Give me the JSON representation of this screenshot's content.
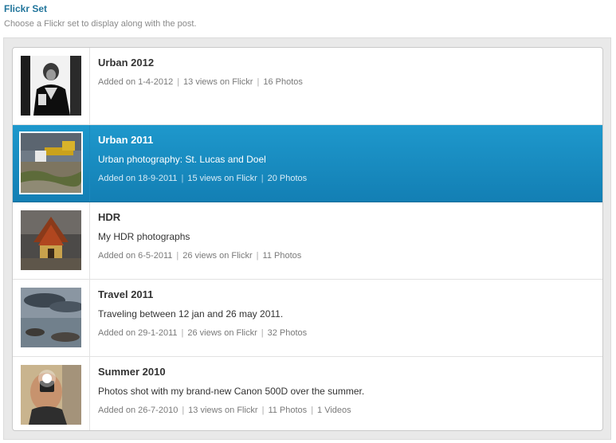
{
  "field": {
    "heading": "Flickr Set",
    "description": "Choose a Flickr set to display along with the post."
  },
  "sets": [
    {
      "title": "Urban 2012",
      "description": "",
      "added": "Added on 1-4-2012",
      "views": "13 views on Flickr",
      "photos": "16 Photos",
      "videos": "",
      "selected": false
    },
    {
      "title": "Urban 2011",
      "description": "Urban photography: St. Lucas and Doel",
      "added": "Added on 18-9-2011",
      "views": "15 views on Flickr",
      "photos": "20 Photos",
      "videos": "",
      "selected": true
    },
    {
      "title": "HDR",
      "description": "My HDR photographs",
      "added": "Added on 6-5-2011",
      "views": "26 views on Flickr",
      "photos": "11 Photos",
      "videos": "",
      "selected": false
    },
    {
      "title": "Travel 2011",
      "description": "Traveling between 12 jan and 26 may 2011.",
      "added": "Added on 29-1-2011",
      "views": "26 views on Flickr",
      "photos": "32 Photos",
      "videos": "",
      "selected": false
    },
    {
      "title": "Summer 2010",
      "description": "Photos shot with my brand-new Canon 500D over the summer.",
      "added": "Added on 26-7-2010",
      "views": "13 views on Flickr",
      "photos": "11 Photos",
      "videos": "1 Videos",
      "selected": false
    }
  ],
  "colors": {
    "heading": "#21759b",
    "selected_bg": "#1a8cc2"
  }
}
